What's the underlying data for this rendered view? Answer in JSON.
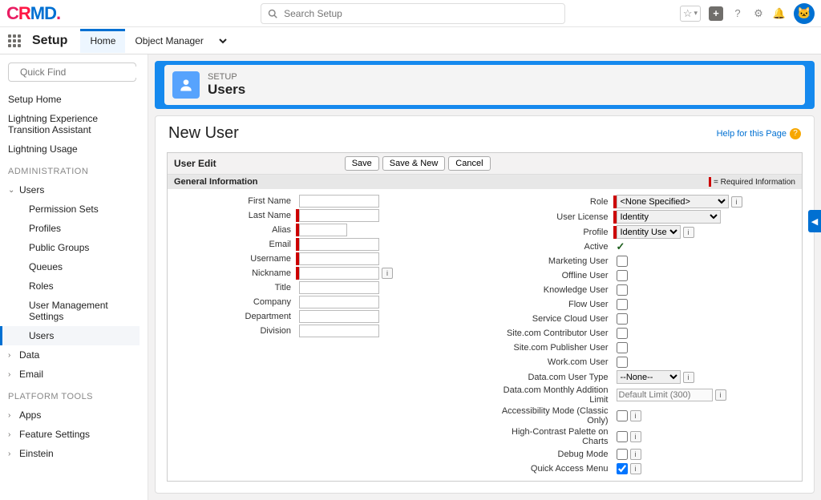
{
  "header": {
    "search_placeholder": "Search Setup"
  },
  "nav": {
    "title": "Setup",
    "tabs": {
      "home": "Home",
      "object_mgr": "Object Manager"
    }
  },
  "sidebar": {
    "quickfind_placeholder": "Quick Find",
    "links": {
      "setup_home": "Setup Home",
      "lightning_transition": "Lightning Experience Transition Assistant",
      "lightning_usage": "Lightning Usage"
    },
    "admin_label": "ADMINISTRATION",
    "users": {
      "label": "Users",
      "items": {
        "permission_sets": "Permission Sets",
        "profiles": "Profiles",
        "public_groups": "Public Groups",
        "queues": "Queues",
        "roles": "Roles",
        "user_mgmt": "User Management Settings",
        "users": "Users"
      }
    },
    "data": "Data",
    "email": "Email",
    "platform_label": "PLATFORM TOOLS",
    "apps": "Apps",
    "feature_settings": "Feature Settings",
    "einstein": "Einstein"
  },
  "hero": {
    "label": "SETUP",
    "title": "Users"
  },
  "panel": {
    "title": "New User",
    "help": "Help for this Page",
    "edit_label": "User Edit",
    "buttons": {
      "save": "Save",
      "save_new": "Save & New",
      "cancel": "Cancel"
    },
    "section": "General Information",
    "required_legend": "= Required Information"
  },
  "fields_left": {
    "first_name": "First Name",
    "last_name": "Last Name",
    "alias": "Alias",
    "email": "Email",
    "username": "Username",
    "nickname": "Nickname",
    "title": "Title",
    "company": "Company",
    "department": "Department",
    "division": "Division"
  },
  "fields_right": {
    "role": "Role",
    "role_value": "<None Specified>",
    "user_license": "User License",
    "user_license_value": "Identity",
    "profile": "Profile",
    "profile_value": "Identity User",
    "active": "Active",
    "marketing_user": "Marketing User",
    "offline_user": "Offline User",
    "knowledge_user": "Knowledge User",
    "flow_user": "Flow User",
    "service_cloud_user": "Service Cloud User",
    "site_contributor": "Site.com Contributor User",
    "site_publisher": "Site.com Publisher User",
    "work_com_user": "Work.com User",
    "data_com_user_type": "Data.com User Type",
    "data_com_user_type_value": "--None--",
    "data_com_monthly": "Data.com Monthly Addition Limit",
    "data_com_monthly_value": "Default Limit (300)",
    "accessibility": "Accessibility Mode (Classic Only)",
    "high_contrast": "High-Contrast Palette on Charts",
    "debug_mode": "Debug Mode",
    "quick_access": "Quick Access Menu"
  }
}
